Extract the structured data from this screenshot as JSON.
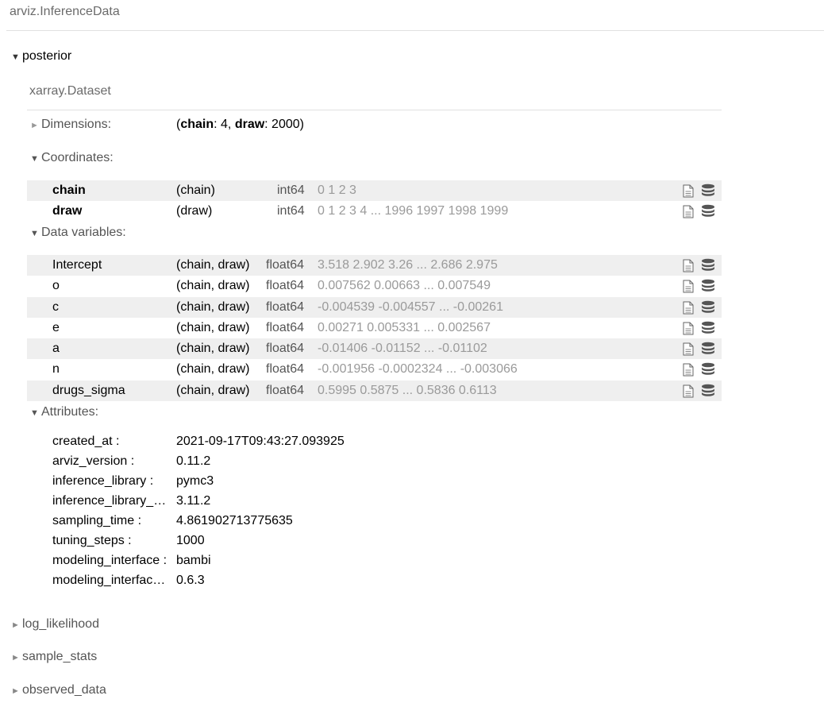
{
  "header": {
    "title": "arviz.InferenceData"
  },
  "groups": [
    {
      "label": "posterior",
      "expanded": true
    },
    {
      "label": "log_likelihood",
      "expanded": false
    },
    {
      "label": "sample_stats",
      "expanded": false
    },
    {
      "label": "observed_data",
      "expanded": false
    }
  ],
  "dataset": {
    "title": "xarray.Dataset",
    "sections": {
      "dimensions": "Dimensions:",
      "coordinates": "Coordinates:",
      "data_variables": "Data variables:",
      "attributes": "Attributes:"
    },
    "dimensions": {
      "open": "(",
      "close": ")",
      "items": [
        {
          "name": "chain",
          "sep": ": ",
          "size": "4",
          "tail": ", "
        },
        {
          "name": "draw",
          "sep": ": ",
          "size": "2000",
          "tail": ""
        }
      ]
    },
    "coordinates": [
      {
        "name": "chain",
        "dims": "(chain)",
        "dtype": "int64",
        "preview": "0 1 2 3"
      },
      {
        "name": "draw",
        "dims": "(draw)",
        "dtype": "int64",
        "preview": "0 1 2 3 4 ... 1996 1997 1998 1999"
      }
    ],
    "data_variables": [
      {
        "name": "Intercept",
        "dims": "(chain, draw)",
        "dtype": "float64",
        "preview": "3.518 2.902 3.26 ... 2.686 2.975"
      },
      {
        "name": "o",
        "dims": "(chain, draw)",
        "dtype": "float64",
        "preview": "0.007562 0.00663 ... 0.007549"
      },
      {
        "name": "c",
        "dims": "(chain, draw)",
        "dtype": "float64",
        "preview": "-0.004539 -0.004557 ... -0.00261"
      },
      {
        "name": "e",
        "dims": "(chain, draw)",
        "dtype": "float64",
        "preview": "0.00271 0.005331 ... 0.002567"
      },
      {
        "name": "a",
        "dims": "(chain, draw)",
        "dtype": "float64",
        "preview": "-0.01406 -0.01152 ... -0.01102"
      },
      {
        "name": "n",
        "dims": "(chain, draw)",
        "dtype": "float64",
        "preview": "-0.001956 -0.0002324 ... -0.003066"
      },
      {
        "name": "drugs_sigma",
        "dims": "(chain, draw)",
        "dtype": "float64",
        "preview": "0.5995 0.5875 ... 0.5836 0.6113"
      }
    ],
    "attributes": [
      {
        "key": "created_at :",
        "value": "2021-09-17T09:43:27.093925"
      },
      {
        "key": "arviz_version :",
        "value": "0.11.2"
      },
      {
        "key": "inference_library :",
        "value": "pymc3"
      },
      {
        "key": "inference_library_version :",
        "value": "3.11.2"
      },
      {
        "key": "sampling_time :",
        "value": "4.861902713775635"
      },
      {
        "key": "tuning_steps :",
        "value": "1000"
      },
      {
        "key": "modeling_interface :",
        "value": "bambi"
      },
      {
        "key": "modeling_interface_version :",
        "value": "0.6.3"
      }
    ]
  },
  "icons": {
    "show_attrs": "file-icon",
    "show_data": "database-icon"
  },
  "colors": {
    "row_shade": "#efefef",
    "preview_text": "#9a9a9a",
    "icon": "#555555"
  }
}
